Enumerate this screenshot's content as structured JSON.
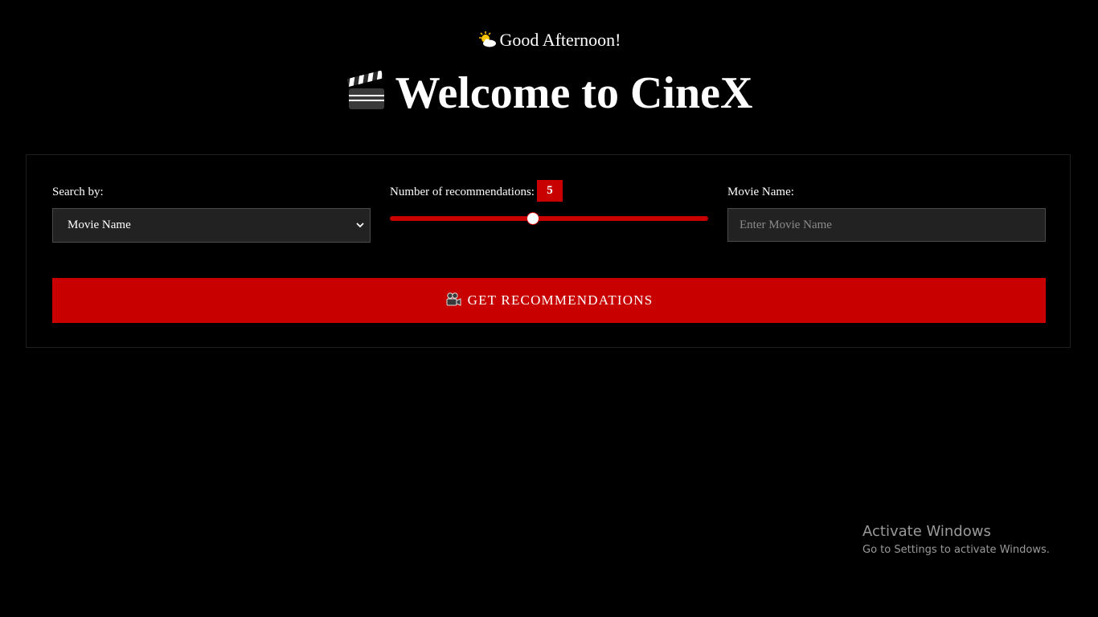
{
  "header": {
    "greeting": "Good Afternoon!",
    "greeting_icon": "sun-behind-cloud-icon",
    "title": "Welcome to CineX",
    "title_icon": "clapperboard-icon"
  },
  "form": {
    "search_by_label": "Search by:",
    "search_by_value": "Movie Name",
    "recommendations_label": "Number of recommendations:",
    "recommendations_value": "5",
    "recommendations_slider": {
      "value": 5,
      "fill_fraction": 0.45
    },
    "movie_name_label": "Movie Name:",
    "movie_name_placeholder": "Enter Movie Name",
    "movie_name_value": "",
    "submit_label": "GET RECOMMENDATIONS",
    "submit_icon": "movie-camera-icon"
  },
  "watermark": {
    "title": "Activate Windows",
    "subtitle": "Go to Settings to activate Windows."
  },
  "colors": {
    "background": "#000000",
    "accent": "#c80000",
    "field_bg": "#222222",
    "text": "#ffffff"
  }
}
